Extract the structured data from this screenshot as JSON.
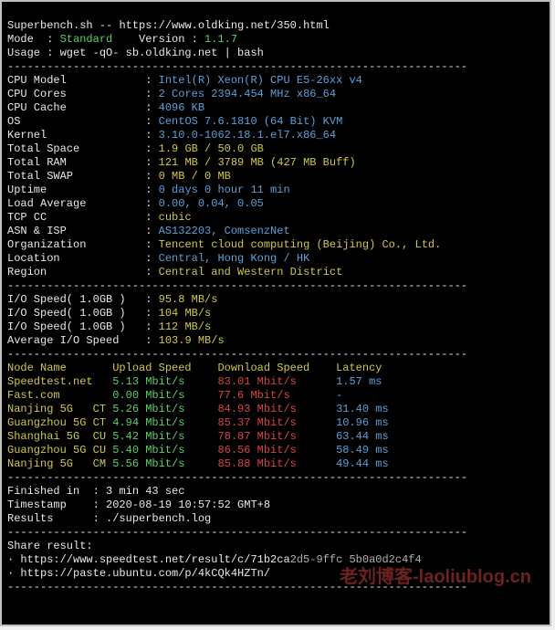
{
  "header": {
    "title": "Superbench.sh",
    "sep1": " -- ",
    "url": "https://www.oldking.net/350.html",
    "mode_label": "Mode  : ",
    "mode_value": "Standard",
    "version_label": "    Version : ",
    "version_value": "1.1.7",
    "usage_label": "Usage : ",
    "usage_value": "wget -qO- sb.oldking.net | bash"
  },
  "hr": "----------------------------------------------------------------------",
  "sys": {
    "rows": [
      {
        "label": "CPU Model            ",
        "value": "Intel(R) Xeon(R) CPU E5-26xx v4",
        "cls": "b"
      },
      {
        "label": "CPU Cores            ",
        "value": "2 Cores 2394.454 MHz x86_64",
        "cls": "b"
      },
      {
        "label": "CPU Cache            ",
        "value": "4096 KB",
        "cls": "b"
      },
      {
        "label": "OS                   ",
        "value": "CentOS 7.6.1810 (64 Bit) KVM",
        "cls": "b"
      },
      {
        "label": "Kernel               ",
        "value": "3.10.0-1062.18.1.el7.x86_64",
        "cls": "b"
      },
      {
        "label": "Total Space          ",
        "value": "1.9 GB / 50.0 GB",
        "cls": "y"
      },
      {
        "label": "Total RAM            ",
        "value": "121 MB / 3789 MB (427 MB Buff)",
        "cls": "y"
      },
      {
        "label": "Total SWAP           ",
        "value": "0 MB / 0 MB",
        "cls": "y"
      },
      {
        "label": "Uptime               ",
        "value": "0 days 0 hour 11 min",
        "cls": "b"
      },
      {
        "label": "Load Average         ",
        "value": "0.00, 0.04, 0.05",
        "cls": "b"
      },
      {
        "label": "TCP CC               ",
        "value": "cubic",
        "cls": "y"
      },
      {
        "label": "ASN & ISP            ",
        "value": "AS132203, ComsenzNet",
        "cls": "b"
      },
      {
        "label": "Organization         ",
        "value": "Tencent cloud computing (Beijing) Co., Ltd.",
        "cls": "y"
      },
      {
        "label": "Location             ",
        "value": "Central, Hong Kong / HK",
        "cls": "b"
      },
      {
        "label": "Region               ",
        "value": "Central and Western District",
        "cls": "y"
      }
    ]
  },
  "io": {
    "r1_label": "I/O Speed( 1.0GB )   ",
    "r1_value": "95.8 MB/s",
    "r2_label": "I/O Speed( 1.0GB )   ",
    "r2_value": "104 MB/s",
    "r3_label": "I/O Speed( 1.0GB )   ",
    "r3_value": "112 MB/s",
    "avg_label": "Average I/O Speed    ",
    "avg_value": "103.9 MB/s"
  },
  "speed": {
    "header": {
      "node": "Node Name       ",
      "up": "Upload Speed    ",
      "down": "Download Speed    ",
      "lat": "Latency     "
    },
    "rows": [
      {
        "node": "Speedtest.net   ",
        "up": "5.13 Mbit/s     ",
        "down": "83.01 Mbit/s      ",
        "lat": "1.57 ms     "
      },
      {
        "node": "Fast.com        ",
        "up": "0.00 Mbit/s     ",
        "down": "77.6 Mbit/s       ",
        "lat": "-           "
      },
      {
        "node": "Nanjing 5G   CT ",
        "up": "5.26 Mbit/s     ",
        "down": "84.93 Mbit/s      ",
        "lat": "31.40 ms    "
      },
      {
        "node": "Guangzhou 5G CT ",
        "up": "4.94 Mbit/s     ",
        "down": "85.37 Mbit/s      ",
        "lat": "10.96 ms    "
      },
      {
        "node": "Shanghai 5G  CU ",
        "up": "5.42 Mbit/s     ",
        "down": "78.87 Mbit/s      ",
        "lat": "63.44 ms    "
      },
      {
        "node": "Guangzhou 5G CU ",
        "up": "5.40 Mbit/s     ",
        "down": "86.56 Mbit/s      ",
        "lat": "58.49 ms    "
      },
      {
        "node": "Nanjing 5G   CM ",
        "up": "5.56 Mbit/s     ",
        "down": "85.88 Mbit/s      ",
        "lat": "49.44 ms    "
      }
    ]
  },
  "footer": {
    "finished_label": "Finished in  ",
    "finished_value": ": 3 min 43 sec",
    "timestamp_label": "Timestamp    ",
    "timestamp_value": ": 2020-08-19 10:57:52 GMT+8",
    "results_label": "Results      ",
    "results_value": ": ./superbench.log",
    "share_label": "Share result:",
    "share1": "· https://www.speedtest.net/result/c/71b2ca",
    "share1b": "2d5-9ffc 5b0a0d2c4f4",
    "share2": "· https://paste.ubuntu.com/p/4kCQk4HZTn/"
  },
  "watermark": "老刘博客-laoliublog.cn"
}
